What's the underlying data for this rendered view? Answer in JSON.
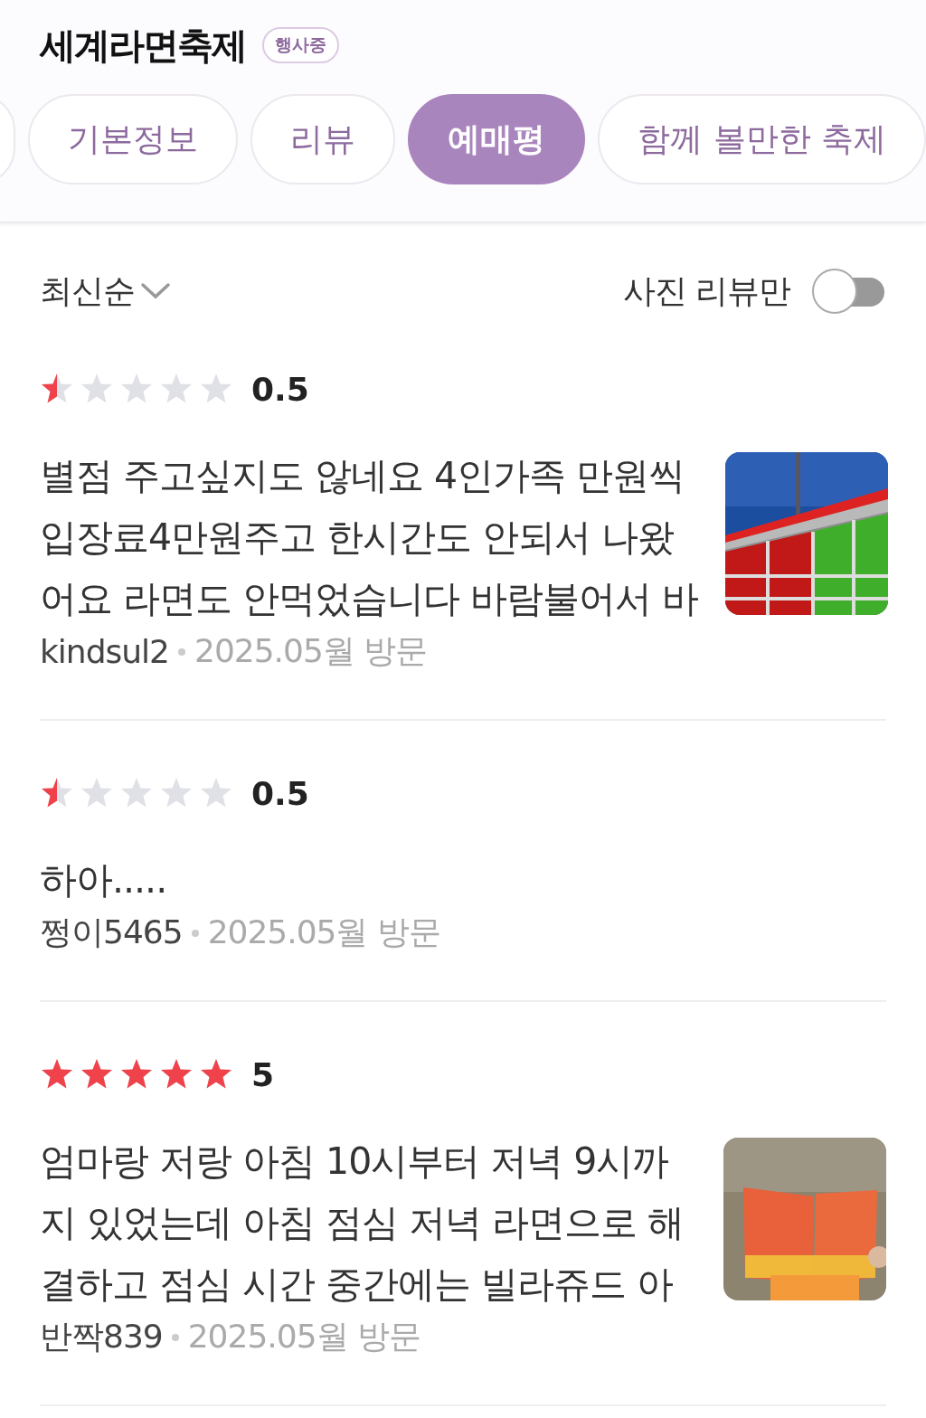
{
  "header": {
    "title": "세계라면축제",
    "badge": "행사중"
  },
  "tabs": [
    {
      "label": "기본정보",
      "selected": false
    },
    {
      "label": "리뷰",
      "selected": false
    },
    {
      "label": "예매평",
      "selected": true
    },
    {
      "label": "함께 볼만한 축제",
      "selected": false
    }
  ],
  "sort": {
    "label": "최신순"
  },
  "photo_filter": {
    "label": "사진 리뷰만",
    "on": false
  },
  "reviews": [
    {
      "stars": 0.5,
      "rating": "0.5",
      "text_lines": [
        "별점 주고싶지도 않네요 4인가족 만원씩",
        "입장료4만원주고 한시간도 안되서 나왔",
        "어요 라면도 안먹었습니다 바람불어서 바"
      ],
      "author": "kindsul2",
      "visit": "2025.05월 방문",
      "photo": {
        "kind": "picture"
      }
    },
    {
      "stars": 0.5,
      "rating": "0.5",
      "text_lines": [
        "하아....."
      ],
      "author": "쩡이5465",
      "visit": "2025.05월 방문"
    },
    {
      "stars": 5,
      "rating": "5",
      "text_lines": [
        "엄마랑 저랑 아침 10시부터 저녁 9시까",
        "지 있었는데 아침 점심 저녁 라면으로 해",
        "결하고 점심 시간 중간에는 빌라쥬드 아"
      ],
      "author": "반짝839",
      "visit": "2025.05월 방문",
      "photo": {
        "kind": "picture"
      }
    }
  ]
}
